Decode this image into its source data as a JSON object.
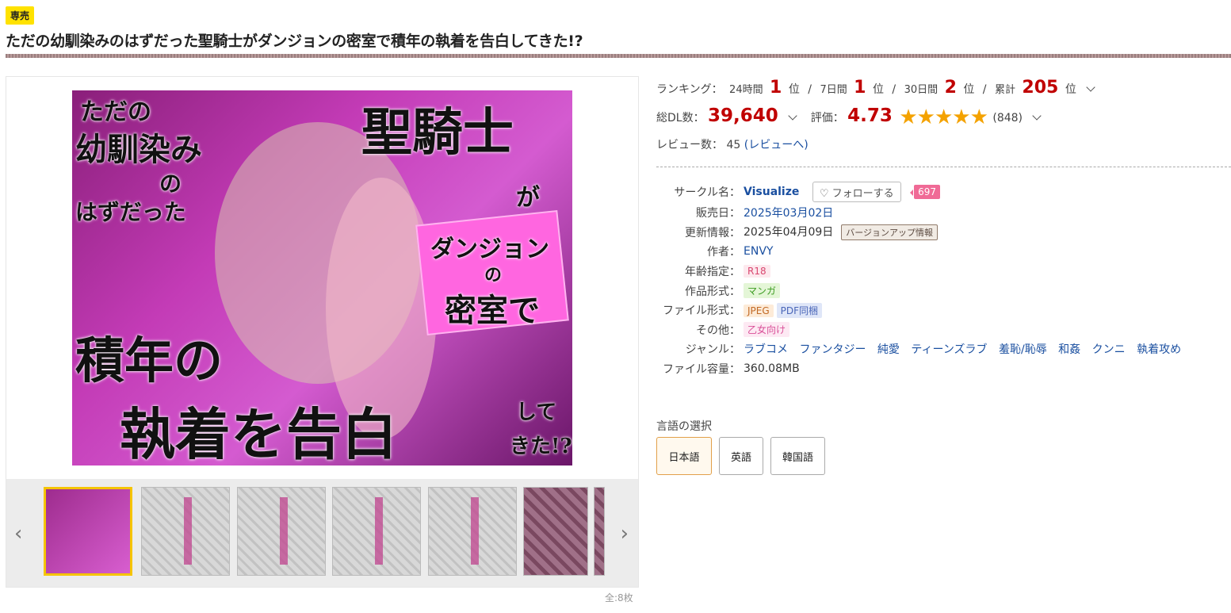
{
  "badge": "専売",
  "title": "ただの幼馴染みのはずだった聖騎士がダンジョンの密室で積年の執着を告白してきた!?",
  "cover": {
    "line1": "ただの",
    "line2": "幼馴染み",
    "line3": "の",
    "line4": "はずだった",
    "line5": "聖騎士",
    "line6": "が",
    "line7": "ダンジョン",
    "line8": "の",
    "line9": "密室で",
    "line10": "積年の",
    "line11": "執着を告白",
    "line12": "して",
    "line13": "きた!?"
  },
  "gallery": {
    "count_text": "全:8枚",
    "prev": "‹",
    "next": "›"
  },
  "ranking": {
    "label": "ランキング：",
    "h24_label": "24時間",
    "h24_value": "1",
    "h24_unit": "位",
    "d7_label": "7日間",
    "d7_value": "1",
    "d7_unit": "位",
    "d30_label": "30日間",
    "d30_value": "2",
    "d30_unit": "位",
    "total_label": "累計",
    "total_value": "205",
    "total_unit": "位",
    "sep": "/"
  },
  "downloads": {
    "label": "総DL数：",
    "value": "39,640"
  },
  "rating": {
    "label": "評価：",
    "value": "4.73",
    "stars": "★★★★★",
    "count": "(848)"
  },
  "reviews": {
    "label": "レビュー数：",
    "value": "45",
    "link_open": "(",
    "link": "レビューへ",
    "link_close": ")"
  },
  "spec": {
    "circle_label": "サークル名：",
    "circle": "Visualize",
    "follow": "フォローする",
    "follow_count": "697",
    "release_label": "販売日：",
    "release": "2025年03月02日",
    "update_label": "更新情報：",
    "update": "2025年04月09日",
    "update_tag": "バージョンアップ情報",
    "author_label": "作者：",
    "author": "ENVY",
    "age_label": "年齢指定：",
    "age": "R18",
    "format_label": "作品形式：",
    "format": "マンガ",
    "file_label": "ファイル形式：",
    "file1": "JPEG",
    "file2": "PDF同梱",
    "other_label": "その他：",
    "other": "乙女向け",
    "genre_label": "ジャンル：",
    "genres": [
      "ラブコメ",
      "ファンタジー",
      "純愛",
      "ティーンズラブ",
      "羞恥/恥辱",
      "和姦",
      "クンニ",
      "執着攻め"
    ],
    "size_label": "ファイル容量：",
    "size": "360.08MB"
  },
  "language": {
    "label": "言語の選択",
    "options": [
      "日本語",
      "英語",
      "韓国語"
    ],
    "selected": "日本語"
  },
  "colors": {
    "accent_red": "#c00000",
    "badge_yellow": "#ffe200",
    "link_blue": "#1a4fa0",
    "star": "#f4a200",
    "follow_pink": "#f06a96"
  }
}
